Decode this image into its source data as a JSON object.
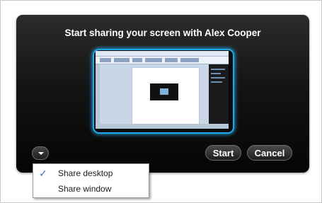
{
  "dialog": {
    "title": "Start sharing your screen with Alex Cooper",
    "start_label": "Start",
    "cancel_label": "Cancel"
  },
  "menu": {
    "items": [
      {
        "label": "Share desktop",
        "checked": true,
        "icon": "checkmark-icon"
      },
      {
        "label": "Share window",
        "checked": false
      }
    ]
  },
  "colors": {
    "preview_border": "#1da9ec",
    "check": "#2f6fc7"
  }
}
